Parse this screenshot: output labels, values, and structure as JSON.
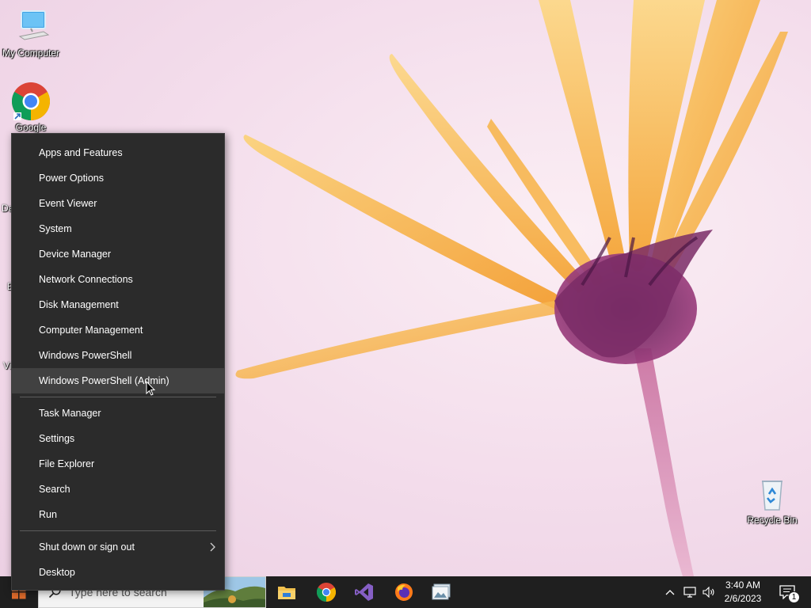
{
  "desktop": {
    "icons": {
      "my_computer": "My Computer",
      "google_chrome": "Google",
      "recycle_bin": "Recycle Bin"
    },
    "edge_fragments": [
      "Da",
      "E",
      "Vi"
    ]
  },
  "context_menu": {
    "items_group1": [
      "Apps and Features",
      "Power Options",
      "Event Viewer",
      "System",
      "Device Manager",
      "Network Connections",
      "Disk Management",
      "Computer Management",
      "Windows PowerShell",
      "Windows PowerShell (Admin)"
    ],
    "items_group2": [
      "Task Manager",
      "Settings",
      "File Explorer",
      "Search",
      "Run"
    ],
    "items_group3": [
      "Shut down or sign out",
      "Desktop"
    ],
    "highlighted_item": "Windows PowerShell (Admin)"
  },
  "taskbar": {
    "search_placeholder": "Type here to search",
    "pinned_apps": [
      "file-explorer-icon",
      "chrome-icon",
      "visual-studio-icon",
      "firefox-icon",
      "image-viewer-icon"
    ],
    "clock": {
      "time": "3:40 AM",
      "date": "2/6/2023"
    },
    "notification_count": "1"
  },
  "colors": {
    "menu_bg": "#2b2b2b",
    "menu_hover": "#414141",
    "taskbar_bg": "#1f1f1f",
    "flower_orange": "#f8b43c",
    "flower_purple": "#7a2c66"
  }
}
